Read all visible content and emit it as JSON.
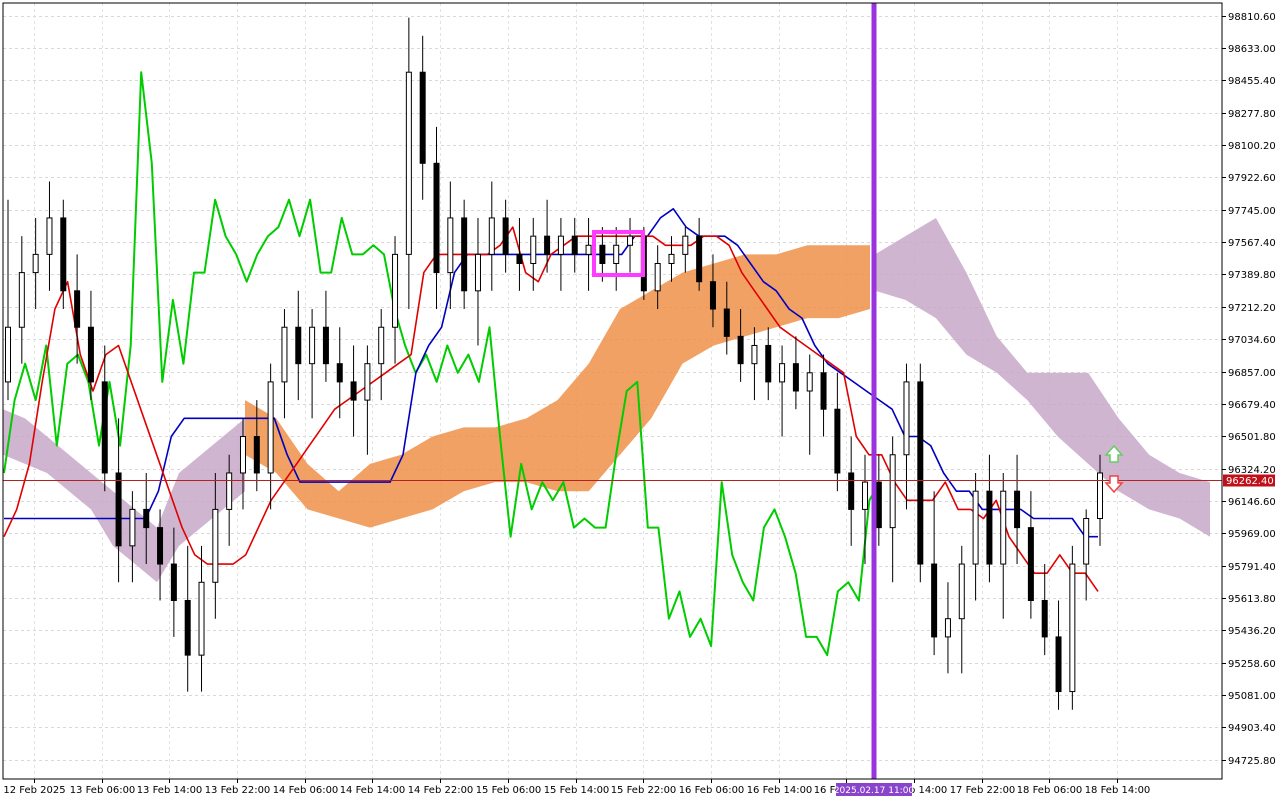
{
  "chart_data": {
    "type": "candlestick",
    "title": "",
    "xlabel": "",
    "ylabel": "",
    "ylim": [
      94620,
      98880
    ],
    "price_ticks": [
      "98810.60",
      "98633.00",
      "98455.40",
      "98277.80",
      "98100.20",
      "97922.60",
      "97745.00",
      "97567.40",
      "97389.80",
      "97212.20",
      "97034.60",
      "96857.00",
      "96679.40",
      "96501.80",
      "96324.20",
      "96146.60",
      "95969.00",
      "95791.40",
      "95613.80",
      "95436.20",
      "95258.60",
      "95081.00",
      "94903.40",
      "94725.80"
    ],
    "date_ticks": [
      "12 Feb 2025",
      "13 Feb 06:00",
      "13 Feb 14:00",
      "13 Feb 22:00",
      "14 Feb 06:00",
      "14 Feb 14:00",
      "14 Feb 22:00",
      "15 Feb 06:00",
      "15 Feb 14:00",
      "15 Feb 22:00",
      "16 Feb 06:00",
      "16 Feb 14:00",
      "16 Feb 22:00",
      "17 Feb 14:00",
      "17 Feb 22:00",
      "18 Feb 06:00",
      "18 Feb 14:00"
    ],
    "current_price": "96262.40",
    "vline_label": "2025.02.17 11:00",
    "grid": true,
    "series": [
      {
        "name": "",
        "kind": "tenkan",
        "color": "#e00000",
        "values": [
          95950,
          96100,
          96350,
          96800,
          97200,
          97350,
          96950,
          96750,
          96950,
          97000,
          96800,
          96600,
          96400,
          96200,
          96000,
          95850,
          95800,
          95800,
          95800,
          95850,
          96000,
          96150,
          96250,
          96350,
          96450,
          96550,
          96650,
          96700,
          96750,
          96800,
          96850,
          96900,
          96950,
          97400,
          97500,
          97500,
          97500,
          97500,
          97500,
          97550,
          97650,
          97400,
          97350,
          97500,
          97550,
          97600,
          97600,
          97600,
          97600,
          97600,
          97600,
          97600,
          97550,
          97550,
          97550,
          97600,
          97600,
          97550,
          97400,
          97300,
          97200,
          97100,
          97050,
          97000,
          96950,
          96900,
          96850,
          96500,
          96400,
          96400,
          96250,
          96150,
          96150,
          96150,
          96250,
          96100,
          96100,
          96050,
          96150,
          95950,
          95850,
          95750,
          95750,
          95850,
          95750,
          95750,
          95650
        ]
      },
      {
        "name": "",
        "kind": "kijun",
        "color": "#0000c0",
        "values": [
          96050,
          96050,
          96050,
          96050,
          96050,
          96050,
          96050,
          96050,
          96050,
          96050,
          96050,
          96050,
          96200,
          96500,
          96600,
          96600,
          96600,
          96600,
          96600,
          96600,
          96600,
          96600,
          96400,
          96250,
          96250,
          96250,
          96250,
          96250,
          96250,
          96250,
          96250,
          96400,
          96850,
          97000,
          97100,
          97400,
          97500,
          97500,
          97500,
          97500,
          97500,
          97500,
          97500,
          97500,
          97500,
          97500,
          97500,
          97500,
          97500,
          97600,
          97600,
          97700,
          97750,
          97650,
          97600,
          97600,
          97600,
          97550,
          97450,
          97350,
          97300,
          97200,
          97150,
          97000,
          96900,
          96850,
          96800,
          96750,
          96700,
          96650,
          96500,
          96500,
          96450,
          96300,
          96200,
          96200,
          96100,
          96100,
          96100,
          96100,
          96050,
          96050,
          96050,
          96050,
          95950,
          95950
        ]
      },
      {
        "name": "",
        "kind": "chikou",
        "color": "#00cc00",
        "values": [
          96300,
          96700,
          96900,
          96700,
          97000,
          96450,
          96900,
          96950,
          96800,
          96450,
          96800,
          96450,
          97000,
          98500,
          98000,
          96800,
          97250,
          96900,
          97400,
          97400,
          97800,
          97600,
          97500,
          97350,
          97500,
          97600,
          97650,
          97800,
          97600,
          97800,
          97400,
          97400,
          97700,
          97500,
          97500,
          97550,
          97500,
          97200,
          97000,
          96850,
          96950,
          96800,
          97000,
          96850,
          96950,
          96800,
          97100,
          96500,
          95950,
          96350,
          96100,
          96250,
          96150,
          96250,
          96000,
          96050,
          96000,
          96000,
          96400,
          96750,
          96800,
          96000,
          96000,
          95500,
          95650,
          95400,
          95500,
          95350,
          96250,
          95850,
          95700,
          95600,
          96000,
          96100,
          95950,
          95750,
          95400,
          95400,
          95300,
          95650,
          95700,
          95600,
          96150,
          96250
        ]
      },
      {
        "name": "",
        "kind": "cloud_a",
        "color": "#f0904a"
      },
      {
        "name": "",
        "kind": "cloud_b",
        "color": "#c8a8c8"
      }
    ],
    "candles_ohlc": [
      [
        96800,
        97800,
        96700,
        97100
      ],
      [
        97100,
        97600,
        96900,
        97400
      ],
      [
        97400,
        97700,
        97200,
        97500
      ],
      [
        97500,
        97900,
        97300,
        97700
      ],
      [
        97700,
        97800,
        97200,
        97300
      ],
      [
        97300,
        97500,
        96900,
        97100
      ],
      [
        97100,
        97300,
        96700,
        96800
      ],
      [
        96800,
        97000,
        96200,
        96300
      ],
      [
        96300,
        96600,
        95700,
        95900
      ],
      [
        95900,
        96200,
        95700,
        96100
      ],
      [
        96100,
        96300,
        95800,
        96000
      ],
      [
        96000,
        96100,
        95600,
        95800
      ],
      [
        95800,
        96000,
        95400,
        95600
      ],
      [
        95600,
        95900,
        95100,
        95300
      ],
      [
        95300,
        95900,
        95100,
        95700
      ],
      [
        95700,
        96300,
        95500,
        96100
      ],
      [
        96100,
        96400,
        95900,
        96300
      ],
      [
        96300,
        96600,
        96100,
        96500
      ],
      [
        96500,
        96700,
        96200,
        96300
      ],
      [
        96300,
        96900,
        96100,
        96800
      ],
      [
        96800,
        97200,
        96600,
        97100
      ],
      [
        97100,
        97300,
        96700,
        96900
      ],
      [
        96900,
        97200,
        96600,
        97100
      ],
      [
        97100,
        97300,
        96800,
        96900
      ],
      [
        96900,
        97100,
        96600,
        96800
      ],
      [
        96800,
        97000,
        96500,
        96700
      ],
      [
        96700,
        97000,
        96400,
        96900
      ],
      [
        96900,
        97200,
        96700,
        97100
      ],
      [
        97100,
        97600,
        96900,
        97500
      ],
      [
        97500,
        98800,
        97200,
        98500
      ],
      [
        98500,
        98700,
        97800,
        98000
      ],
      [
        98000,
        98200,
        97200,
        97400
      ],
      [
        97400,
        97900,
        97200,
        97700
      ],
      [
        97700,
        97800,
        97200,
        97300
      ],
      [
        97300,
        97700,
        97000,
        97500
      ],
      [
        97500,
        97900,
        97300,
        97700
      ],
      [
        97700,
        97800,
        97400,
        97500
      ],
      [
        97500,
        97700,
        97300,
        97450
      ],
      [
        97450,
        97700,
        97300,
        97600
      ],
      [
        97600,
        97800,
        97400,
        97500
      ],
      [
        97500,
        97700,
        97300,
        97600
      ],
      [
        97600,
        97700,
        97400,
        97500
      ],
      [
        97500,
        97700,
        97300,
        97550
      ],
      [
        97550,
        97650,
        97350,
        97450
      ],
      [
        97450,
        97650,
        97300,
        97550
      ],
      [
        97550,
        97700,
        97400,
        97600
      ],
      [
        97600,
        97650,
        97250,
        97300
      ],
      [
        97300,
        97550,
        97200,
        97450
      ],
      [
        97450,
        97600,
        97350,
        97500
      ],
      [
        97500,
        97650,
        97400,
        97600
      ],
      [
        97600,
        97700,
        97300,
        97350
      ],
      [
        97350,
        97500,
        97100,
        97200
      ],
      [
        97200,
        97350,
        96950,
        97050
      ],
      [
        97050,
        97200,
        96800,
        96900
      ],
      [
        96900,
        97100,
        96700,
        97000
      ],
      [
        97000,
        97100,
        96700,
        96800
      ],
      [
        96800,
        97000,
        96500,
        96900
      ],
      [
        96900,
        97050,
        96650,
        96750
      ],
      [
        96750,
        96950,
        96400,
        96850
      ],
      [
        96850,
        96950,
        96500,
        96650
      ],
      [
        96650,
        96850,
        96200,
        96300
      ],
      [
        96300,
        96500,
        95900,
        96100
      ],
      [
        96100,
        96400,
        95800,
        96250
      ],
      [
        96250,
        96400,
        95900,
        96000
      ],
      [
        96000,
        96500,
        95700,
        96400
      ],
      [
        96400,
        96900,
        96100,
        96800
      ],
      [
        96800,
        96900,
        95700,
        95800
      ],
      [
        95800,
        96200,
        95300,
        95400
      ],
      [
        95400,
        95700,
        95200,
        95500
      ],
      [
        95500,
        95900,
        95200,
        95800
      ],
      [
        95800,
        96300,
        95600,
        96200
      ],
      [
        96200,
        96400,
        95700,
        95800
      ],
      [
        95800,
        96300,
        95500,
        96200
      ],
      [
        96200,
        96400,
        95800,
        96000
      ],
      [
        96000,
        96200,
        95500,
        95600
      ],
      [
        95600,
        95800,
        95300,
        95400
      ],
      [
        95400,
        95600,
        95000,
        95100
      ],
      [
        95100,
        95900,
        95000,
        95800
      ],
      [
        95800,
        96100,
        95600,
        96050
      ],
      [
        96050,
        96400,
        95900,
        96300
      ]
    ],
    "cloud_a_band": [
      [
        96400,
        96700
      ],
      [
        96300,
        96600
      ],
      [
        96100,
        96350
      ],
      [
        96050,
        96200
      ],
      [
        96000,
        96350
      ],
      [
        96050,
        96400
      ],
      [
        96100,
        96500
      ],
      [
        96200,
        96550
      ],
      [
        96250,
        96550
      ],
      [
        96250,
        96600
      ],
      [
        96200,
        96700
      ],
      [
        96200,
        96900
      ],
      [
        96400,
        97200
      ],
      [
        96600,
        97300
      ],
      [
        96900,
        97400
      ],
      [
        97000,
        97450
      ],
      [
        97050,
        97500
      ],
      [
        97100,
        97500
      ],
      [
        97150,
        97550
      ],
      [
        97150,
        97550
      ],
      [
        97200,
        97550
      ]
    ],
    "cloud_b_band": [
      [
        96400,
        96650
      ],
      [
        96350,
        96600
      ],
      [
        96300,
        96500
      ],
      [
        96200,
        96400
      ],
      [
        96100,
        96300
      ],
      [
        95900,
        96200
      ],
      [
        95800,
        96100
      ],
      [
        95700,
        96000
      ],
      [
        95900,
        96300
      ],
      [
        96000,
        96400
      ],
      [
        96100,
        96500
      ],
      [
        96200,
        96600
      ]
    ],
    "cloud_c_band": [
      [
        97300,
        97500
      ],
      [
        97250,
        97600
      ],
      [
        97150,
        97700
      ],
      [
        96950,
        97400
      ],
      [
        96850,
        97050
      ],
      [
        96700,
        96850
      ],
      [
        96500,
        96850
      ],
      [
        96350,
        96850
      ],
      [
        96200,
        96600
      ],
      [
        96100,
        96400
      ],
      [
        96050,
        96300
      ],
      [
        95950,
        96250
      ]
    ]
  }
}
